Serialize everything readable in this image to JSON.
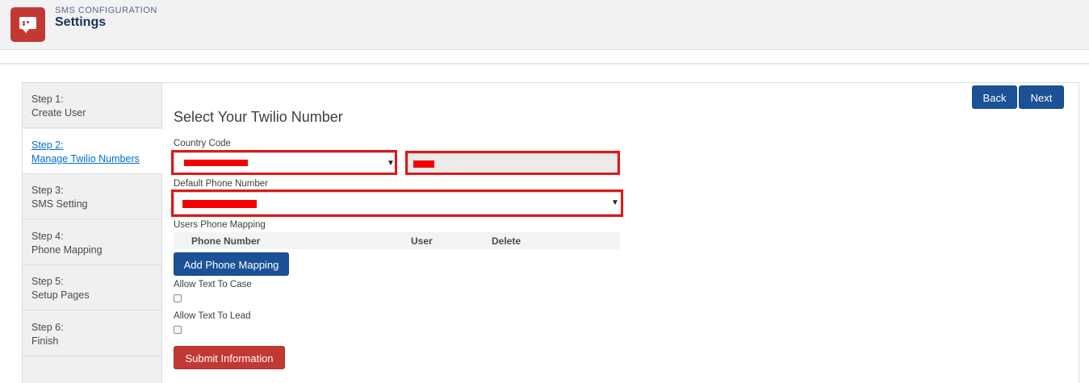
{
  "header": {
    "subtitle": "SMS CONFIGURATION",
    "title": "Settings",
    "app_icon": "chat-bubble-icon",
    "brand_color": "#c23934"
  },
  "steps": [
    {
      "num": "Step 1:",
      "label": "Create User",
      "active": false
    },
    {
      "num": "Step 2:",
      "label": "Manage Twilio Numbers",
      "active": true
    },
    {
      "num": "Step 3:",
      "label": "SMS Setting",
      "active": false
    },
    {
      "num": "Step 4:",
      "label": "Phone Mapping",
      "active": false
    },
    {
      "num": "Step 5:",
      "label": "Setup Pages",
      "active": false
    },
    {
      "num": "Step 6:",
      "label": "Finish",
      "active": false
    }
  ],
  "nav": {
    "back_label": "Back",
    "next_label": "Next"
  },
  "form": {
    "section_title": "Select Your Twilio Number",
    "country_code_label": "Country Code",
    "default_phone_label": "Default Phone Number",
    "users_mapping_label": "Users Phone Mapping",
    "table_headers": [
      "Phone Number",
      "User",
      "Delete"
    ],
    "add_mapping_label": "Add Phone Mapping",
    "allow_case_label": "Allow Text To Case",
    "allow_lead_label": "Allow Text To Lead",
    "submit_label": "Submit Information",
    "allow_case_checked": false,
    "allow_lead_checked": false
  },
  "colors": {
    "primary_button": "#1b5297",
    "submit_button": "#c23934",
    "highlight_outline": "#e21717"
  }
}
